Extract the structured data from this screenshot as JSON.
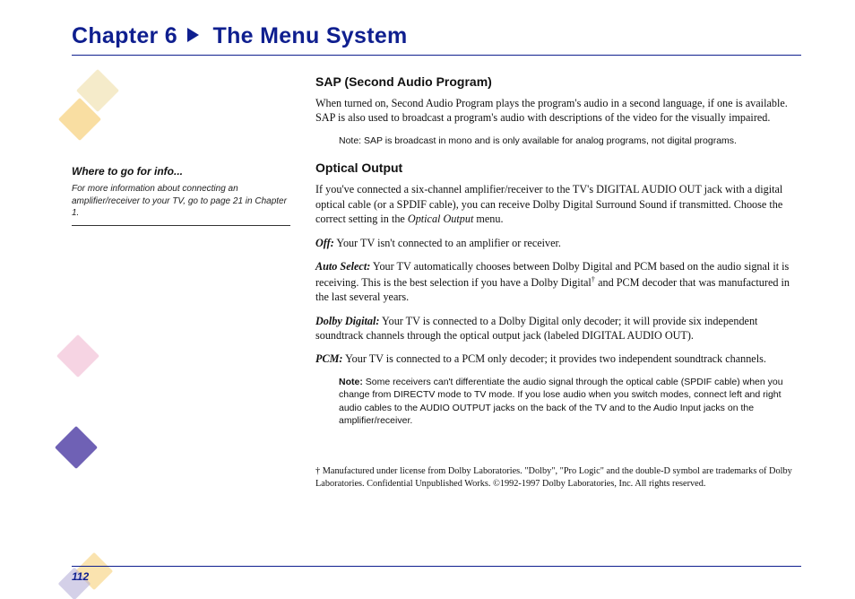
{
  "header": {
    "chapter_prefix": "Chapter 6",
    "chapter_title": "The Menu System"
  },
  "sidebar": {
    "heading": "Where to go for info...",
    "body": "For more information about connecting an amplifier/receiver to your TV, go to page 21 in Chapter 1."
  },
  "sections": {
    "sap": {
      "heading": "SAP (Second Audio Program)",
      "paragraph": "When turned on, Second Audio Program plays the program's audio in a second language, if one is available.  SAP is also used to broadcast a program's audio with descriptions of the video for the visually impaired.",
      "note": "Note: SAP is broadcast in mono and is only available for analog programs, not digital programs."
    },
    "optical": {
      "heading": "Optical Output",
      "intro_pre": "If you've connected a six-channel amplifier/receiver to the TV's DIGITAL AUDIO OUT jack with a digital optical cable (or a SPDIF cable), you can receive Dolby Digital Surround Sound if transmitted.  Choose the correct setting in the ",
      "intro_ital": "Optical Output",
      "intro_post": " menu.",
      "off": {
        "label": "Off:",
        "text": "   Your TV isn't connected to an amplifier or receiver."
      },
      "auto": {
        "label": "Auto Select:",
        "text_pre": " Your TV automatically chooses between Dolby Digital and PCM based on the audio signal it is receiving. This is the best selection if you have a Dolby Digital",
        "sup": "†",
        "text_post": " and PCM decoder that was manufactured in the last several years."
      },
      "dolby": {
        "label": "Dolby Digital:",
        "text": "  Your TV is connected to a Dolby Digital only decoder; it will provide six independent soundtrack channels through the optical output jack (labeled DIGITAL AUDIO OUT)."
      },
      "pcm": {
        "label": "PCM:",
        "text": "   Your TV is connected to a PCM only decoder; it provides two independent soundtrack channels."
      },
      "note_label": "Note:",
      "note_body": " Some receivers can't differentiate the audio signal through the optical cable (SPDIF cable) when you change from DIRECTV mode to TV mode. If you lose audio when you switch modes, connect left and right audio cables to the AUDIO OUTPUT jacks on the back of the TV and to the Audio Input jacks on the amplifier/receiver."
    }
  },
  "footnote": "† Manufactured under license from Dolby Laboratories. \"Dolby\", \"Pro Logic\" and the double-D symbol are trademarks of Dolby Laboratories. Confidential Unpublished Works. ©1992-1997 Dolby Laboratories, Inc. All rights reserved.",
  "page_number": "112"
}
